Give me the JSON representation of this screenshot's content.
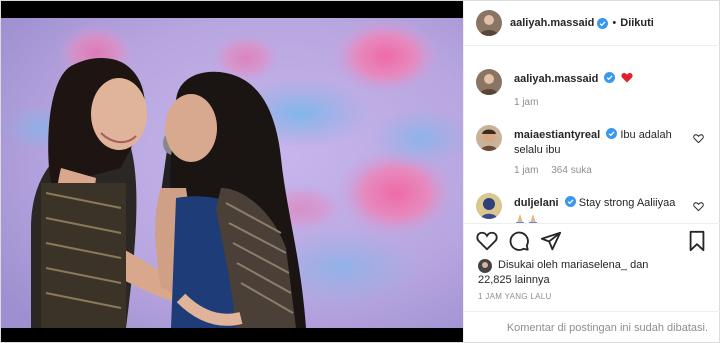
{
  "header": {
    "username": "aaliyah.massaid",
    "separator": "•",
    "follow_status": "Diikuti"
  },
  "comments": [
    {
      "username": "aaliyah.massaid",
      "text": "",
      "emoji": "heart-emoji",
      "time": "1 jam"
    },
    {
      "username": "maiaestiantyreal",
      "text": "Ibu adalah selalu ibu",
      "time": "1 jam",
      "likes": "364 suka"
    },
    {
      "username": "duljelani",
      "text": "Stay strong Aaliiyaa",
      "emoji": "praying-hands-emoji"
    }
  ],
  "likes": {
    "line1": "Disukai oleh mariaselena_ dan",
    "line2": "22,825 lainnya"
  },
  "time_ago": "1 JAM YANG LALU",
  "footer_text": "Komentar di postingan ini sudah dibatasi.",
  "colors": {
    "verified": "#3897f0",
    "heart": "#ed4956",
    "muted": "#8e8e8e",
    "border": "#efefef"
  }
}
